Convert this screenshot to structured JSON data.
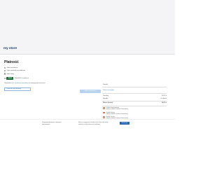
{
  "header": {
    "logo": "my store"
  },
  "payment": {
    "title": "Płatność",
    "options": [
      "Opłać przelewem",
      "Opłać gotówką przy odbiorze",
      "Opłać kartą"
    ],
    "blik": {
      "badge": "BLIK",
      "label": "Kody BLIK w aplikacji"
    },
    "terms_text": "Zapoznałem się z",
    "terms_link": "regulaminem sprzedaży",
    "terms_rest": "i akceptuję jego postanowienia.",
    "back_button": "Powrót do opcji dostawy",
    "pay_button": "Opłać zamówienie"
  },
  "summary": {
    "heading": "Produkt",
    "detail_link": "Pokaż szczegóły",
    "rows": [
      {
        "label": "Produkty",
        "value": "18,87 zł"
      },
      {
        "label": "Wysyłka",
        "value": "Za darmo"
      }
    ],
    "total_label": "Razem (brutto)",
    "total_value": "18,87 zł",
    "features": [
      {
        "title": "Polityka bezpieczeństwa",
        "subtitle": "(edytuj w module Customer Reassurance)"
      },
      {
        "title": "Zasady dostawy",
        "subtitle": "(edytuj w module Customer Reassurance)"
      },
      {
        "title": "Zasady zwrotów",
        "subtitle": "(edytuj w module Customer Reassurance)"
      }
    ]
  },
  "footer": {
    "left_line1": "Otrzymuj informacje o naszych",
    "left_line2": "najnowszych",
    "mid_line1": "Możesz zrezygnować w każdej chwili. W tym celu należy",
    "mid_line2": "odnaleźć w stopce informacje kontaktowe",
    "subscribe": "Subskrybuj"
  },
  "colors": {
    "accent": "#2a7ab8",
    "blik": "#1e6f3a",
    "icon": "#e07a3c",
    "button": "#1f62ad"
  }
}
